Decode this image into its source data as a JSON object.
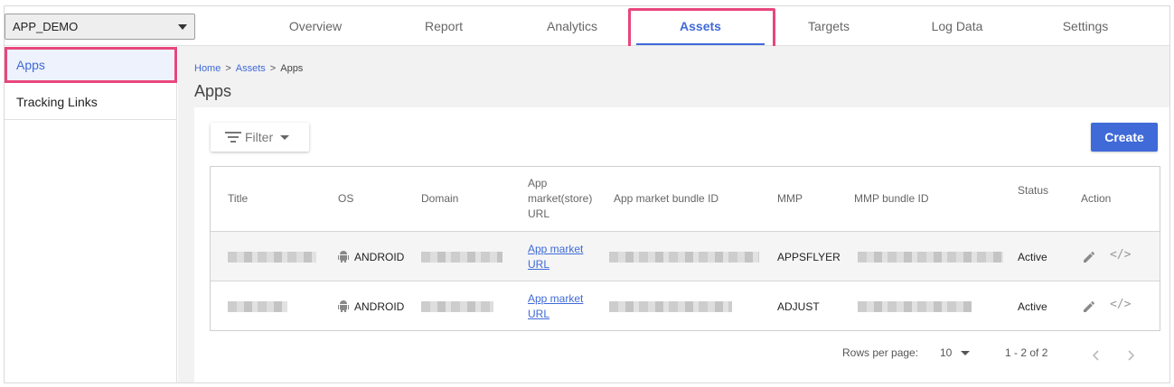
{
  "app_select": {
    "value": "APP_DEMO"
  },
  "tabs": [
    {
      "label": "Overview"
    },
    {
      "label": "Report"
    },
    {
      "label": "Analytics"
    },
    {
      "label": "Assets"
    },
    {
      "label": "Targets"
    },
    {
      "label": "Log Data"
    },
    {
      "label": "Settings"
    }
  ],
  "active_tab": "Assets",
  "sidebar": {
    "items": [
      {
        "label": "Apps"
      },
      {
        "label": "Tracking Links"
      }
    ]
  },
  "breadcrumb": {
    "items": [
      "Home",
      "Assets",
      "Apps"
    ],
    "separator": ">"
  },
  "page_title": "Apps",
  "toolbar": {
    "filter_label": "Filter",
    "create_label": "Create"
  },
  "table": {
    "headers": {
      "title": "Title",
      "os": "OS",
      "domain": "Domain",
      "store_url_1": "App",
      "store_url_2": "market(store)",
      "store_url_3": "URL",
      "bundle_id": "App market bundle ID",
      "mmp": "MMP",
      "mmp_bundle_id": "MMP bundle ID",
      "status": "Status",
      "action": "Action"
    },
    "rows": [
      {
        "os": "ANDROID",
        "store_link_1": "App market",
        "store_link_2": "URL",
        "mmp": "APPSFLYER",
        "status": "Active"
      },
      {
        "os": "ANDROID",
        "store_link_1": "App market",
        "store_link_2": "URL",
        "mmp": "ADJUST",
        "status": "Active"
      }
    ]
  },
  "pagination": {
    "rows_per_page_label": "Rows per page:",
    "rows_per_page": "10",
    "range": "1 - 2 of 2"
  },
  "colors": {
    "accent": "#3f6ad8",
    "highlight": "#e8467c"
  },
  "icons": [
    "caret-down-icon",
    "filter-icon",
    "android-icon",
    "pencil-icon",
    "code-icon",
    "chevron-left-icon",
    "chevron-right-icon",
    "collapse-sidebar-icon"
  ]
}
